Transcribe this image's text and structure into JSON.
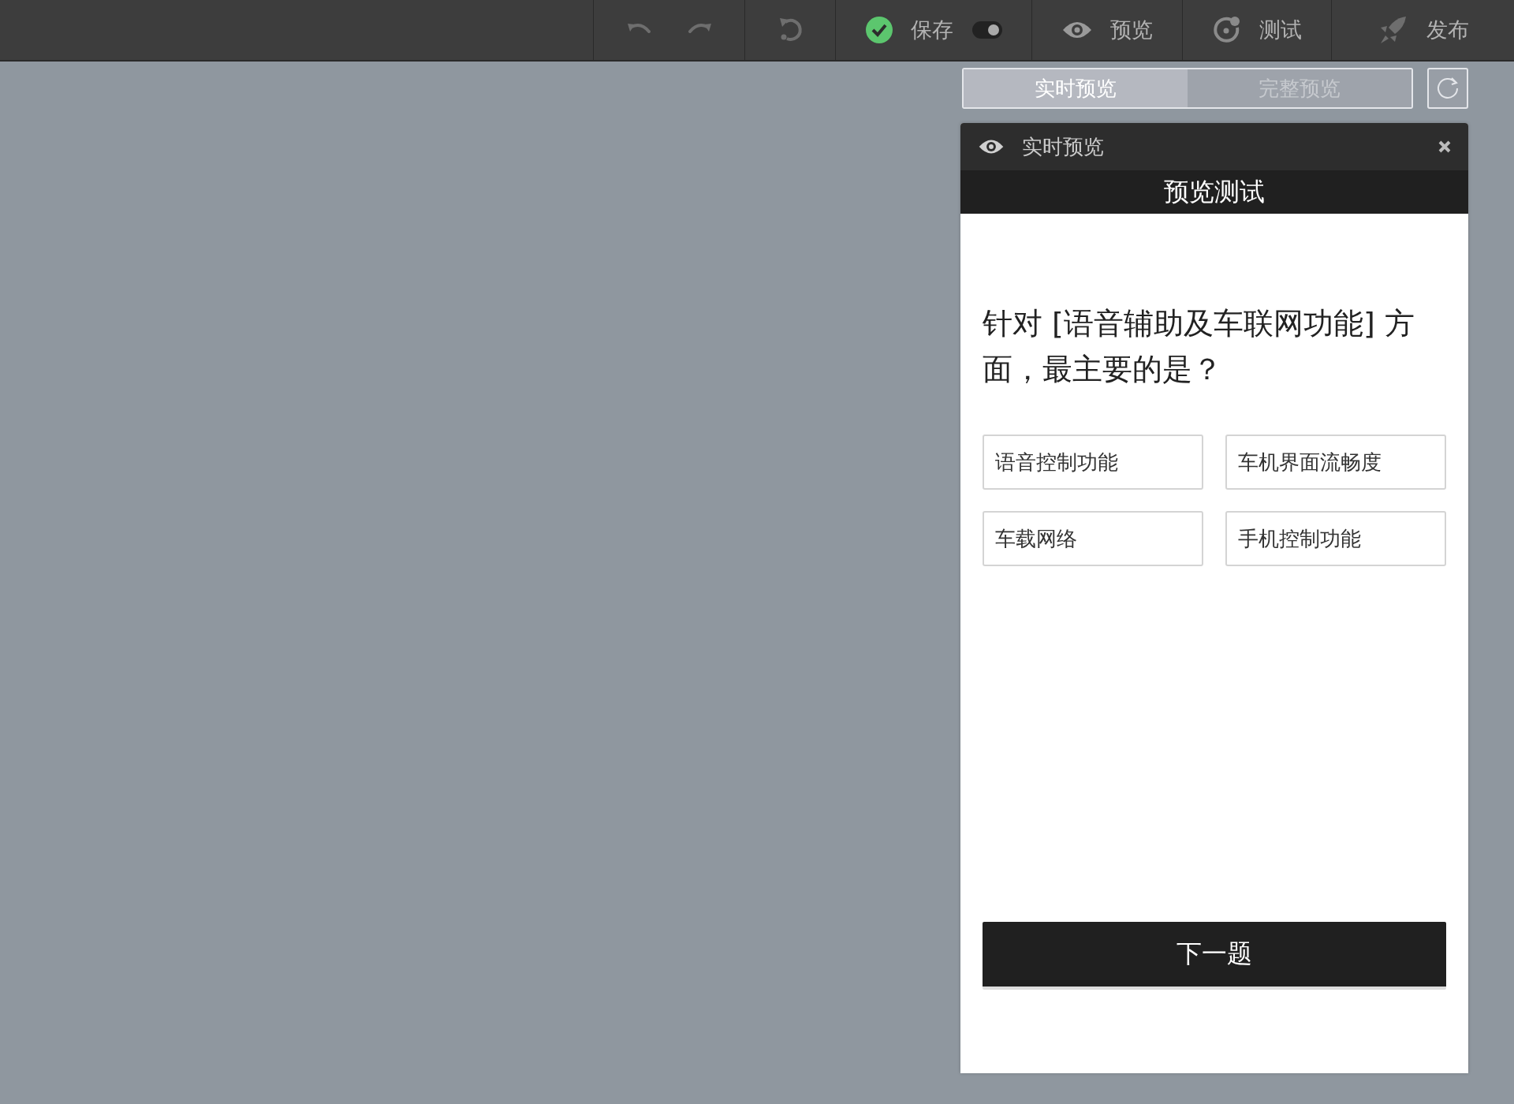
{
  "toolbar": {
    "save": {
      "label": "保存",
      "toggle_on": true
    },
    "preview": {
      "label": "预览"
    },
    "test": {
      "label": "测试"
    },
    "publish": {
      "label": "发布"
    }
  },
  "preview_modes": [
    {
      "label": "实时预览",
      "selected": true
    },
    {
      "label": "完整预览",
      "selected": false
    }
  ],
  "panel": {
    "title": "实时预览",
    "page_title": "预览测试",
    "question": "针对 [语音辅助及车联网功能] 方面，最主要的是？",
    "options": [
      {
        "label": "语音控制功能",
        "selected": false
      },
      {
        "label": "车机界面流畅度",
        "selected": false
      },
      {
        "label": "车载网络",
        "selected": false
      },
      {
        "label": "手机控制功能",
        "selected": false
      }
    ],
    "next_button": "下一题"
  }
}
